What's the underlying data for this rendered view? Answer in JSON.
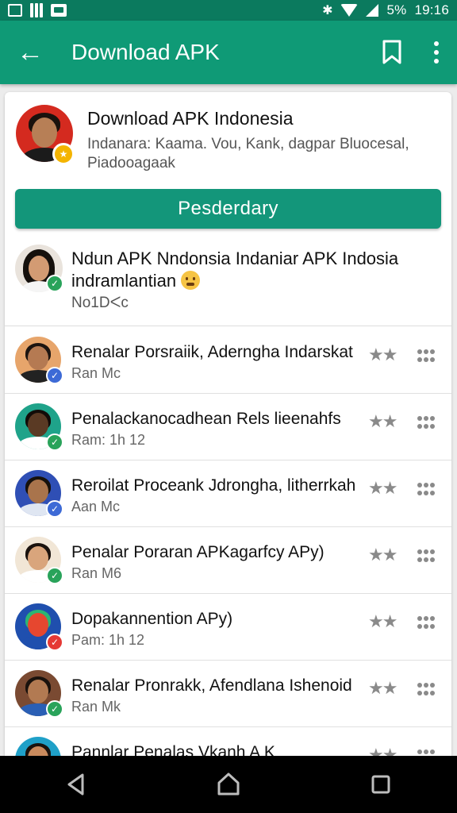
{
  "status_bar": {
    "battery": "5%",
    "time": "19:16"
  },
  "app_bar": {
    "title": "Download APK"
  },
  "header": {
    "title": "Download APK Indonesia",
    "subtitle": "Indanara: Kaama. Vou, Kank, dagpar Bluocesal, Piadooagaak"
  },
  "primary_button": {
    "label": "Pesderdary"
  },
  "featured": {
    "title_line1": "Ndun APK Nndonsia Indaniar APK Indosia",
    "title_line2": "indramlantian",
    "meta": "No1Dᐸc"
  },
  "list_items": [
    {
      "title": "Renalar Porsraiik, Aderngha Indarskat",
      "subtitle": "Ran Mc",
      "rating": "★★",
      "avatar_bg": "#e7a56b",
      "badge_color": "#3d6ad6",
      "skin": "#b57a52",
      "hair": "#1c1410",
      "shirt": "#222222"
    },
    {
      "title": "Penalackanocadhean Rels lieenahfs",
      "subtitle": "Ram: 1h 12",
      "rating": "★★",
      "avatar_bg": "#1fa38a",
      "badge_color": "#29a35a",
      "skin": "#5a3a24",
      "hair": "#120c08",
      "shirt": "#ffffff"
    },
    {
      "title": "Reroilat Proceank Jdrongha, litherrkah",
      "subtitle": "Aan Mc",
      "rating": "★★",
      "avatar_bg": "#2f4fb5",
      "badge_color": "#3d6ad6",
      "skin": "#a9744c",
      "hair": "#16110c",
      "shirt": "#dfe6f2"
    },
    {
      "title": "Penalar Poraran APKagarfcy APy)",
      "subtitle": "Ran M6",
      "rating": "★★",
      "avatar_bg": "#f1e6d6",
      "badge_color": "#29a35a",
      "skin": "#d9a57c",
      "hair": "#1a120d",
      "shirt": "#ffffff"
    },
    {
      "title": "Dopakannention APy)",
      "subtitle": "Pam: 1h 12",
      "rating": "★★",
      "avatar_bg": "#1f4fae",
      "badge_color": "#e53935",
      "skin": "#e6472f",
      "hair": "#2bb673",
      "shirt": "#1f4fae"
    },
    {
      "title": "Renalar Pronrakk, Afendlana Ishenoid",
      "subtitle": "Ran Mk",
      "rating": "★★",
      "avatar_bg": "#7a4a32",
      "badge_color": "#29a35a",
      "skin": "#b27a52",
      "hair": "#1a120d",
      "shirt": "#2a5fb5"
    },
    {
      "title": "Pannlar Penalas Vkanh A K",
      "subtitle": "",
      "rating": "★★",
      "avatar_bg": "#1fa0c8",
      "badge_color": "#29a35a",
      "skin": "#c98a5d",
      "hair": "#1a120d",
      "shirt": "#e0673c"
    }
  ],
  "colors": {
    "status_bar": "#0b7a5e",
    "app_bar": "#0f9a76",
    "primary_button": "#13967a"
  },
  "icons": {
    "back": "arrow-left-icon",
    "bookmark": "bookmark-icon",
    "more": "more-vert-icon"
  }
}
